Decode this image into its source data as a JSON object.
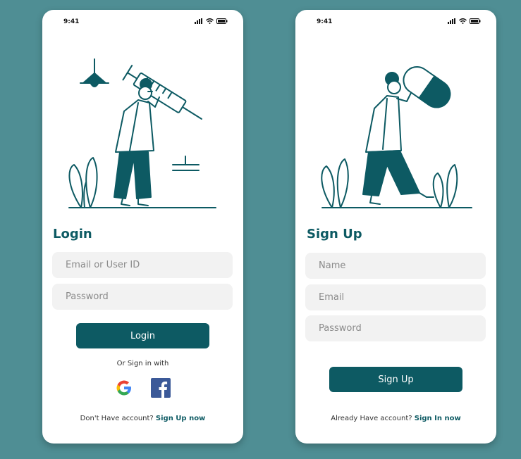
{
  "login": {
    "status_time": "9:41",
    "title": "Login",
    "email_placeholder": "Email or User ID",
    "password_placeholder": "Password",
    "button_label": "Login",
    "or_sign_in": "Or Sign in with",
    "social": [
      "google-icon",
      "facebook-icon"
    ],
    "footer_text": "Don't Have account?",
    "footer_link": "Sign Up now"
  },
  "signup": {
    "status_time": "9:41",
    "title": "Sign Up",
    "name_placeholder": "Name",
    "email_placeholder": "Email",
    "password_placeholder": "Password",
    "button_label": "Sign Up",
    "footer_text": "Already Have account?",
    "footer_link": "Sign In now"
  },
  "colors": {
    "background": "#4f8e94",
    "accent": "#0d5a63",
    "field_bg": "#f2f2f2",
    "card": "#ffffff"
  }
}
